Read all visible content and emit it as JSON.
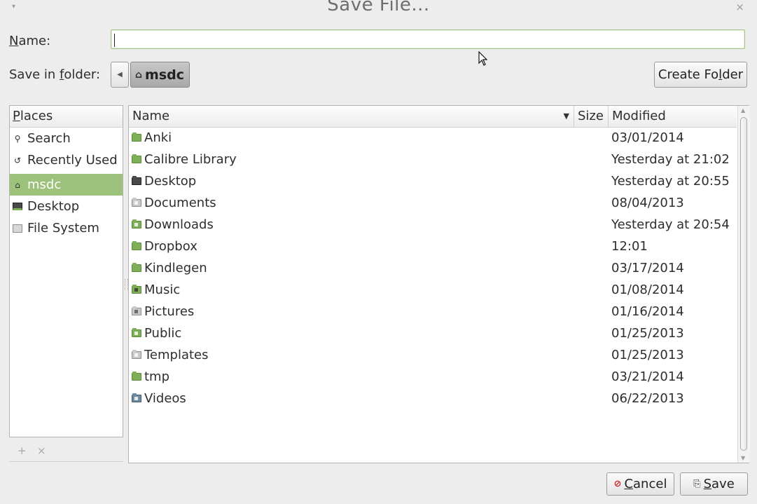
{
  "window": {
    "title": "Save File...",
    "menu_icon": "chevron-down-icon",
    "close_glyph": "×"
  },
  "name_field": {
    "label_prefix": "",
    "label_underlined": "N",
    "label_rest": "ame:",
    "value": "",
    "placeholder": ""
  },
  "folder": {
    "label_prefix": "Save in ",
    "label_underlined": "f",
    "label_rest": "older:",
    "current": "msdc",
    "create_folder_prefix": "Create Fo",
    "create_folder_underlined": "l",
    "create_folder_rest": "der"
  },
  "places": {
    "header_underlined": "P",
    "header_rest": "laces",
    "items": [
      {
        "label": "Search",
        "icon": "search-icon"
      },
      {
        "label": "Recently Used",
        "icon": "recent-icon"
      },
      {
        "label": "msdc",
        "icon": "home-icon",
        "selected": true
      },
      {
        "label": "Desktop",
        "icon": "desktop-icon"
      },
      {
        "label": "File System",
        "icon": "drive-icon"
      }
    ],
    "add_label": "+",
    "remove_label": "×"
  },
  "files": {
    "columns": {
      "name": "Name",
      "size": "Size",
      "modified": "Modified"
    },
    "rows": [
      {
        "name": "Anki",
        "modified": "03/01/2014",
        "icon": "folder-icon"
      },
      {
        "name": "Calibre Library",
        "modified": "Yesterday at 21:02",
        "icon": "folder-icon"
      },
      {
        "name": "Desktop",
        "modified": "Yesterday at 20:55",
        "icon": "desktop-folder-icon"
      },
      {
        "name": "Documents",
        "modified": "08/04/2013",
        "icon": "documents-folder-icon"
      },
      {
        "name": "Downloads",
        "modified": "Yesterday at 20:54",
        "icon": "downloads-folder-icon"
      },
      {
        "name": "Dropbox",
        "modified": "12:01",
        "icon": "folder-icon"
      },
      {
        "name": "Kindlegen",
        "modified": "03/17/2014",
        "icon": "folder-icon"
      },
      {
        "name": "Music",
        "modified": "01/08/2014",
        "icon": "music-folder-icon"
      },
      {
        "name": "Pictures",
        "modified": "01/16/2014",
        "icon": "pictures-folder-icon"
      },
      {
        "name": "Public",
        "modified": "01/25/2013",
        "icon": "public-folder-icon"
      },
      {
        "name": "Templates",
        "modified": "01/25/2013",
        "icon": "templates-folder-icon"
      },
      {
        "name": "tmp",
        "modified": "03/21/2014",
        "icon": "folder-icon"
      },
      {
        "name": "Videos",
        "modified": "06/22/2013",
        "icon": "videos-folder-icon"
      }
    ]
  },
  "buttons": {
    "cancel_underlined": "C",
    "cancel_rest": "ancel",
    "save_underlined": "S",
    "save_rest": "ave"
  },
  "colors": {
    "accent": "#9cc27c",
    "folder": "#7fae58"
  }
}
